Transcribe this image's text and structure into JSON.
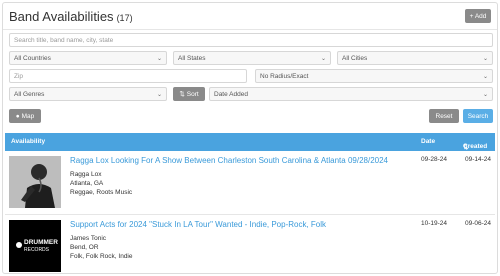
{
  "header": {
    "title": "Band Availabilities",
    "count": "(17)",
    "add_label": "+ Add"
  },
  "search": {
    "placeholder": "Search title, band name, city, state"
  },
  "filters": {
    "country": "All Countries",
    "state": "All States",
    "city": "All Cities",
    "zip_placeholder": "Zip",
    "radius": "No Radius/Exact",
    "genre": "All Genres",
    "sort_label": "Sort",
    "sort_by": "Date Added"
  },
  "buttons": {
    "map": "Map",
    "reset": "Reset",
    "search": "Search"
  },
  "table": {
    "col_availability": "Availability",
    "col_date": "Date",
    "col_created": "Created"
  },
  "rows": [
    {
      "title": "Ragga Lox Looking For A Show Between Charleston South Carolina & Atlanta 09/28/2024",
      "band": "Ragga Lox",
      "location": "Atlanta, GA",
      "genres": "Reggae, Roots Music",
      "date": "09-28-24",
      "created": "09-14-24"
    },
    {
      "title": "Support Acts for 2024 \"Stuck In LA Tour\" Wanted - Indie, Pop-Rock, Folk",
      "band": "James Tonic",
      "location": "Bend, OR",
      "genres": "Folk, Folk Rock, Indie",
      "date": "10-19-24",
      "created": "09-06-24",
      "logo_text_1": "DRUMMER",
      "logo_text_2": "RECORDS"
    }
  ],
  "colors": {
    "accent": "#4aa3df",
    "link": "#3a9ad9",
    "gray_button": "#8a8a8a"
  }
}
